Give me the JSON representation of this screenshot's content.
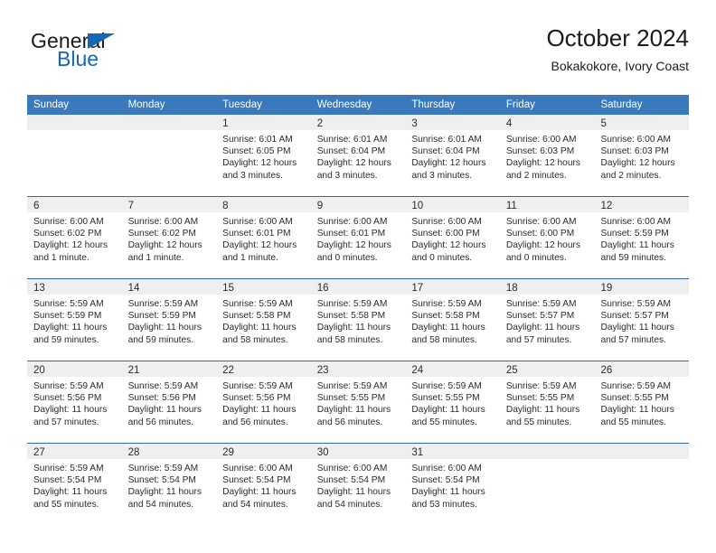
{
  "brand": {
    "name_part1": "General",
    "name_part2": "Blue",
    "accent_color": "#1268b3"
  },
  "header": {
    "title": "October 2024",
    "subtitle": "Bokakokore, Ivory Coast"
  },
  "theme": {
    "header_blue": "#3b79bd",
    "row_divider_blue": "#2f6ca8",
    "day_band_gray": "#efefef",
    "text_color": "#2b2b2b"
  },
  "weekdays": [
    "Sunday",
    "Monday",
    "Tuesday",
    "Wednesday",
    "Thursday",
    "Friday",
    "Saturday"
  ],
  "weeks": [
    [
      {
        "day": "",
        "sunrise": "",
        "sunset": "",
        "daylight": "",
        "empty": true
      },
      {
        "day": "",
        "sunrise": "",
        "sunset": "",
        "daylight": "",
        "empty": true
      },
      {
        "day": "1",
        "sunrise": "Sunrise: 6:01 AM",
        "sunset": "Sunset: 6:05 PM",
        "daylight": "Daylight: 12 hours and 3 minutes."
      },
      {
        "day": "2",
        "sunrise": "Sunrise: 6:01 AM",
        "sunset": "Sunset: 6:04 PM",
        "daylight": "Daylight: 12 hours and 3 minutes."
      },
      {
        "day": "3",
        "sunrise": "Sunrise: 6:01 AM",
        "sunset": "Sunset: 6:04 PM",
        "daylight": "Daylight: 12 hours and 3 minutes."
      },
      {
        "day": "4",
        "sunrise": "Sunrise: 6:00 AM",
        "sunset": "Sunset: 6:03 PM",
        "daylight": "Daylight: 12 hours and 2 minutes."
      },
      {
        "day": "5",
        "sunrise": "Sunrise: 6:00 AM",
        "sunset": "Sunset: 6:03 PM",
        "daylight": "Daylight: 12 hours and 2 minutes."
      }
    ],
    [
      {
        "day": "6",
        "sunrise": "Sunrise: 6:00 AM",
        "sunset": "Sunset: 6:02 PM",
        "daylight": "Daylight: 12 hours and 1 minute."
      },
      {
        "day": "7",
        "sunrise": "Sunrise: 6:00 AM",
        "sunset": "Sunset: 6:02 PM",
        "daylight": "Daylight: 12 hours and 1 minute."
      },
      {
        "day": "8",
        "sunrise": "Sunrise: 6:00 AM",
        "sunset": "Sunset: 6:01 PM",
        "daylight": "Daylight: 12 hours and 1 minute."
      },
      {
        "day": "9",
        "sunrise": "Sunrise: 6:00 AM",
        "sunset": "Sunset: 6:01 PM",
        "daylight": "Daylight: 12 hours and 0 minutes."
      },
      {
        "day": "10",
        "sunrise": "Sunrise: 6:00 AM",
        "sunset": "Sunset: 6:00 PM",
        "daylight": "Daylight: 12 hours and 0 minutes."
      },
      {
        "day": "11",
        "sunrise": "Sunrise: 6:00 AM",
        "sunset": "Sunset: 6:00 PM",
        "daylight": "Daylight: 12 hours and 0 minutes."
      },
      {
        "day": "12",
        "sunrise": "Sunrise: 6:00 AM",
        "sunset": "Sunset: 5:59 PM",
        "daylight": "Daylight: 11 hours and 59 minutes."
      }
    ],
    [
      {
        "day": "13",
        "sunrise": "Sunrise: 5:59 AM",
        "sunset": "Sunset: 5:59 PM",
        "daylight": "Daylight: 11 hours and 59 minutes."
      },
      {
        "day": "14",
        "sunrise": "Sunrise: 5:59 AM",
        "sunset": "Sunset: 5:59 PM",
        "daylight": "Daylight: 11 hours and 59 minutes."
      },
      {
        "day": "15",
        "sunrise": "Sunrise: 5:59 AM",
        "sunset": "Sunset: 5:58 PM",
        "daylight": "Daylight: 11 hours and 58 minutes."
      },
      {
        "day": "16",
        "sunrise": "Sunrise: 5:59 AM",
        "sunset": "Sunset: 5:58 PM",
        "daylight": "Daylight: 11 hours and 58 minutes."
      },
      {
        "day": "17",
        "sunrise": "Sunrise: 5:59 AM",
        "sunset": "Sunset: 5:58 PM",
        "daylight": "Daylight: 11 hours and 58 minutes."
      },
      {
        "day": "18",
        "sunrise": "Sunrise: 5:59 AM",
        "sunset": "Sunset: 5:57 PM",
        "daylight": "Daylight: 11 hours and 57 minutes."
      },
      {
        "day": "19",
        "sunrise": "Sunrise: 5:59 AM",
        "sunset": "Sunset: 5:57 PM",
        "daylight": "Daylight: 11 hours and 57 minutes."
      }
    ],
    [
      {
        "day": "20",
        "sunrise": "Sunrise: 5:59 AM",
        "sunset": "Sunset: 5:56 PM",
        "daylight": "Daylight: 11 hours and 57 minutes."
      },
      {
        "day": "21",
        "sunrise": "Sunrise: 5:59 AM",
        "sunset": "Sunset: 5:56 PM",
        "daylight": "Daylight: 11 hours and 56 minutes."
      },
      {
        "day": "22",
        "sunrise": "Sunrise: 5:59 AM",
        "sunset": "Sunset: 5:56 PM",
        "daylight": "Daylight: 11 hours and 56 minutes."
      },
      {
        "day": "23",
        "sunrise": "Sunrise: 5:59 AM",
        "sunset": "Sunset: 5:55 PM",
        "daylight": "Daylight: 11 hours and 56 minutes."
      },
      {
        "day": "24",
        "sunrise": "Sunrise: 5:59 AM",
        "sunset": "Sunset: 5:55 PM",
        "daylight": "Daylight: 11 hours and 55 minutes."
      },
      {
        "day": "25",
        "sunrise": "Sunrise: 5:59 AM",
        "sunset": "Sunset: 5:55 PM",
        "daylight": "Daylight: 11 hours and 55 minutes."
      },
      {
        "day": "26",
        "sunrise": "Sunrise: 5:59 AM",
        "sunset": "Sunset: 5:55 PM",
        "daylight": "Daylight: 11 hours and 55 minutes."
      }
    ],
    [
      {
        "day": "27",
        "sunrise": "Sunrise: 5:59 AM",
        "sunset": "Sunset: 5:54 PM",
        "daylight": "Daylight: 11 hours and 55 minutes."
      },
      {
        "day": "28",
        "sunrise": "Sunrise: 5:59 AM",
        "sunset": "Sunset: 5:54 PM",
        "daylight": "Daylight: 11 hours and 54 minutes."
      },
      {
        "day": "29",
        "sunrise": "Sunrise: 6:00 AM",
        "sunset": "Sunset: 5:54 PM",
        "daylight": "Daylight: 11 hours and 54 minutes."
      },
      {
        "day": "30",
        "sunrise": "Sunrise: 6:00 AM",
        "sunset": "Sunset: 5:54 PM",
        "daylight": "Daylight: 11 hours and 54 minutes."
      },
      {
        "day": "31",
        "sunrise": "Sunrise: 6:00 AM",
        "sunset": "Sunset: 5:54 PM",
        "daylight": "Daylight: 11 hours and 53 minutes."
      },
      {
        "day": "",
        "sunrise": "",
        "sunset": "",
        "daylight": "",
        "empty": true
      },
      {
        "day": "",
        "sunrise": "",
        "sunset": "",
        "daylight": "",
        "empty": true
      }
    ]
  ]
}
